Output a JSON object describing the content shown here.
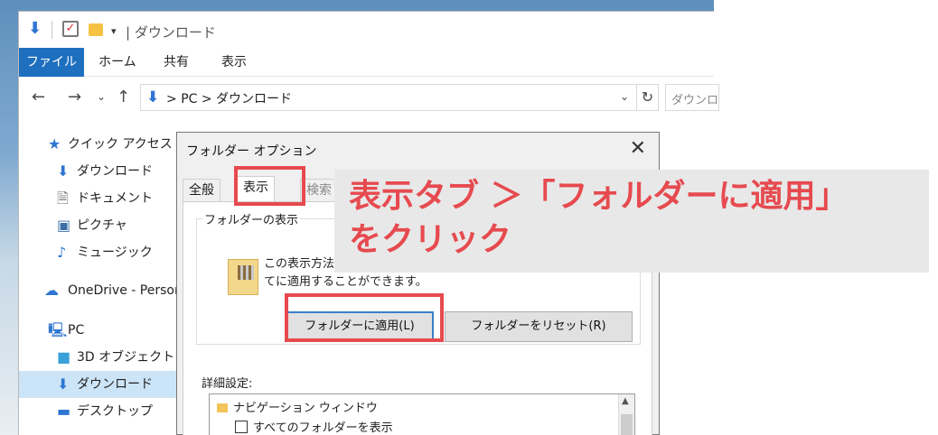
{
  "explorer": {
    "title": "ダウンロード",
    "ribbon_tabs": [
      "ファイル",
      "ホーム",
      "共有",
      "表示"
    ],
    "address": {
      "path": "PC  >  ダウンロード",
      "search_placeholder": "ダウンロー"
    },
    "sidebar": [
      {
        "label": "クイック アクセス",
        "icon": "star-icon"
      },
      {
        "label": "ダウンロード",
        "icon": "download-arrow-icon"
      },
      {
        "label": "ドキュメント",
        "icon": "document-icon"
      },
      {
        "label": "ピクチャ",
        "icon": "pictures-icon"
      },
      {
        "label": "ミュージック",
        "icon": "music-note-icon"
      },
      {
        "label": "OneDrive - Person",
        "icon": "cloud-icon"
      },
      {
        "label": "PC",
        "icon": "pc-icon"
      },
      {
        "label": "3D オブジェクト",
        "icon": "cube-icon"
      },
      {
        "label": "ダウンロード",
        "icon": "download-arrow-icon",
        "selected": true
      },
      {
        "label": "デスクトップ",
        "icon": "desktop-icon"
      }
    ]
  },
  "dialog": {
    "title": "フォルダー オプション",
    "tabs": [
      "全般",
      "表示",
      "検索"
    ],
    "group_label": "フォルダーの表示",
    "group_desc_line1": "この表示方法",
    "group_desc_line2": "てに適用することができます。",
    "apply_button": "フォルダーに適用(L)",
    "reset_button": "フォルダーをリセット(R)",
    "advanced_label": "詳細設定:",
    "advanced_items": [
      "ナビゲーション ウィンドウ",
      "すべてのフォルダーを表示"
    ]
  },
  "annotation": {
    "text": "表示タブ ＞「フォルダーに適用」\nをクリック",
    "color": "#e64a4f"
  },
  "colors": {
    "accent": "#1f6fbf",
    "highlight": "#e64a4f",
    "selection": "#cce4f7"
  }
}
